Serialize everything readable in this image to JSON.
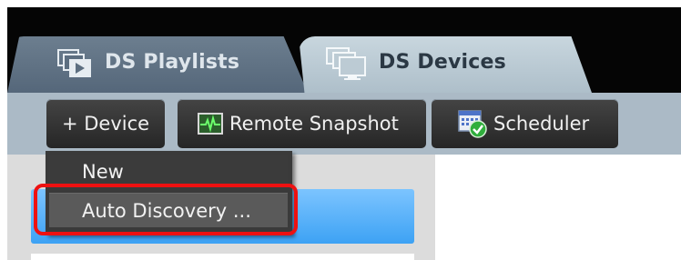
{
  "tabs": [
    {
      "label": "DS Playlists",
      "icon": "playlist-icon"
    },
    {
      "label": "DS Devices",
      "icon": "devices-icon"
    }
  ],
  "toolbar": {
    "device_label": "+ Device",
    "snapshot_label": "Remote Snapshot",
    "snapshot_icon": "snapshot-icon",
    "scheduler_label": "Scheduler",
    "scheduler_icon": "scheduler-icon"
  },
  "menu": {
    "items": [
      {
        "label": "New"
      },
      {
        "label": "Auto Discovery ..."
      }
    ]
  },
  "colors": {
    "accent": "#3da2f4",
    "highlight": "#ee1111",
    "toolbar_bg": "#abbac6",
    "button_bg": "#333333"
  }
}
